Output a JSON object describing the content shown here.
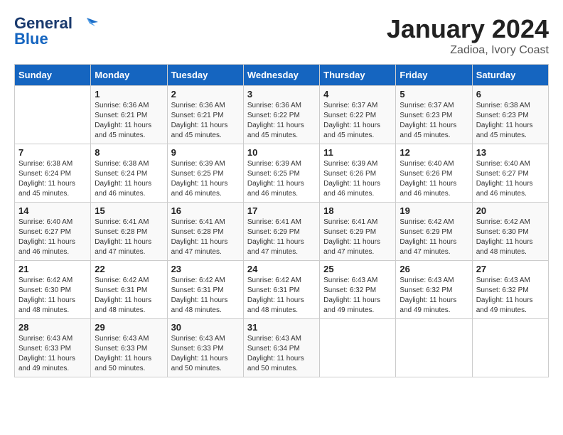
{
  "header": {
    "logo_line1": "General",
    "logo_line2": "Blue",
    "title": "January 2024",
    "subtitle": "Zadioa, Ivory Coast"
  },
  "days_of_week": [
    "Sunday",
    "Monday",
    "Tuesday",
    "Wednesday",
    "Thursday",
    "Friday",
    "Saturday"
  ],
  "weeks": [
    [
      {
        "day": "",
        "info": ""
      },
      {
        "day": "1",
        "info": "Sunrise: 6:36 AM\nSunset: 6:21 PM\nDaylight: 11 hours\nand 45 minutes."
      },
      {
        "day": "2",
        "info": "Sunrise: 6:36 AM\nSunset: 6:21 PM\nDaylight: 11 hours\nand 45 minutes."
      },
      {
        "day": "3",
        "info": "Sunrise: 6:36 AM\nSunset: 6:22 PM\nDaylight: 11 hours\nand 45 minutes."
      },
      {
        "day": "4",
        "info": "Sunrise: 6:37 AM\nSunset: 6:22 PM\nDaylight: 11 hours\nand 45 minutes."
      },
      {
        "day": "5",
        "info": "Sunrise: 6:37 AM\nSunset: 6:23 PM\nDaylight: 11 hours\nand 45 minutes."
      },
      {
        "day": "6",
        "info": "Sunrise: 6:38 AM\nSunset: 6:23 PM\nDaylight: 11 hours\nand 45 minutes."
      }
    ],
    [
      {
        "day": "7",
        "info": "Sunrise: 6:38 AM\nSunset: 6:24 PM\nDaylight: 11 hours\nand 45 minutes."
      },
      {
        "day": "8",
        "info": "Sunrise: 6:38 AM\nSunset: 6:24 PM\nDaylight: 11 hours\nand 46 minutes."
      },
      {
        "day": "9",
        "info": "Sunrise: 6:39 AM\nSunset: 6:25 PM\nDaylight: 11 hours\nand 46 minutes."
      },
      {
        "day": "10",
        "info": "Sunrise: 6:39 AM\nSunset: 6:25 PM\nDaylight: 11 hours\nand 46 minutes."
      },
      {
        "day": "11",
        "info": "Sunrise: 6:39 AM\nSunset: 6:26 PM\nDaylight: 11 hours\nand 46 minutes."
      },
      {
        "day": "12",
        "info": "Sunrise: 6:40 AM\nSunset: 6:26 PM\nDaylight: 11 hours\nand 46 minutes."
      },
      {
        "day": "13",
        "info": "Sunrise: 6:40 AM\nSunset: 6:27 PM\nDaylight: 11 hours\nand 46 minutes."
      }
    ],
    [
      {
        "day": "14",
        "info": "Sunrise: 6:40 AM\nSunset: 6:27 PM\nDaylight: 11 hours\nand 46 minutes."
      },
      {
        "day": "15",
        "info": "Sunrise: 6:41 AM\nSunset: 6:28 PM\nDaylight: 11 hours\nand 47 minutes."
      },
      {
        "day": "16",
        "info": "Sunrise: 6:41 AM\nSunset: 6:28 PM\nDaylight: 11 hours\nand 47 minutes."
      },
      {
        "day": "17",
        "info": "Sunrise: 6:41 AM\nSunset: 6:29 PM\nDaylight: 11 hours\nand 47 minutes."
      },
      {
        "day": "18",
        "info": "Sunrise: 6:41 AM\nSunset: 6:29 PM\nDaylight: 11 hours\nand 47 minutes."
      },
      {
        "day": "19",
        "info": "Sunrise: 6:42 AM\nSunset: 6:29 PM\nDaylight: 11 hours\nand 47 minutes."
      },
      {
        "day": "20",
        "info": "Sunrise: 6:42 AM\nSunset: 6:30 PM\nDaylight: 11 hours\nand 48 minutes."
      }
    ],
    [
      {
        "day": "21",
        "info": "Sunrise: 6:42 AM\nSunset: 6:30 PM\nDaylight: 11 hours\nand 48 minutes."
      },
      {
        "day": "22",
        "info": "Sunrise: 6:42 AM\nSunset: 6:31 PM\nDaylight: 11 hours\nand 48 minutes."
      },
      {
        "day": "23",
        "info": "Sunrise: 6:42 AM\nSunset: 6:31 PM\nDaylight: 11 hours\nand 48 minutes."
      },
      {
        "day": "24",
        "info": "Sunrise: 6:42 AM\nSunset: 6:31 PM\nDaylight: 11 hours\nand 48 minutes."
      },
      {
        "day": "25",
        "info": "Sunrise: 6:43 AM\nSunset: 6:32 PM\nDaylight: 11 hours\nand 49 minutes."
      },
      {
        "day": "26",
        "info": "Sunrise: 6:43 AM\nSunset: 6:32 PM\nDaylight: 11 hours\nand 49 minutes."
      },
      {
        "day": "27",
        "info": "Sunrise: 6:43 AM\nSunset: 6:32 PM\nDaylight: 11 hours\nand 49 minutes."
      }
    ],
    [
      {
        "day": "28",
        "info": "Sunrise: 6:43 AM\nSunset: 6:33 PM\nDaylight: 11 hours\nand 49 minutes."
      },
      {
        "day": "29",
        "info": "Sunrise: 6:43 AM\nSunset: 6:33 PM\nDaylight: 11 hours\nand 50 minutes."
      },
      {
        "day": "30",
        "info": "Sunrise: 6:43 AM\nSunset: 6:33 PM\nDaylight: 11 hours\nand 50 minutes."
      },
      {
        "day": "31",
        "info": "Sunrise: 6:43 AM\nSunset: 6:34 PM\nDaylight: 11 hours\nand 50 minutes."
      },
      {
        "day": "",
        "info": ""
      },
      {
        "day": "",
        "info": ""
      },
      {
        "day": "",
        "info": ""
      }
    ]
  ]
}
